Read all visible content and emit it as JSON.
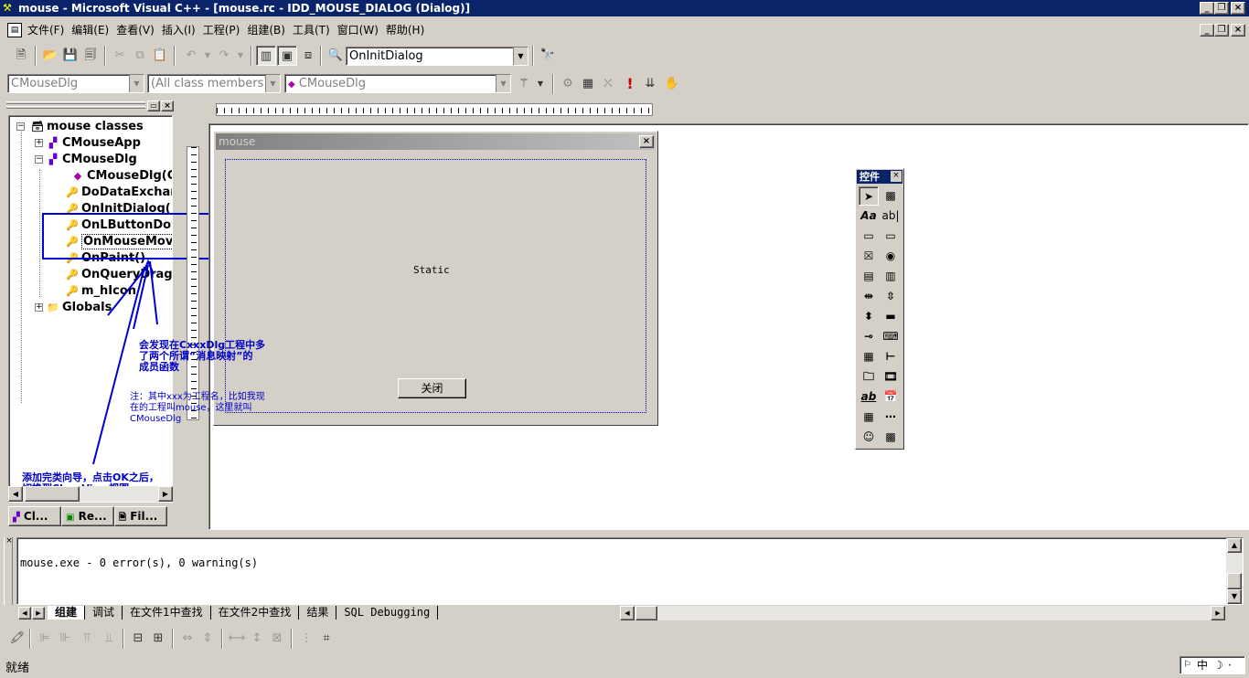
{
  "app": {
    "title": "mouse - Microsoft Visual C++ - [mouse.rc - IDD_MOUSE_DIALOG (Dialog)]",
    "title_buttons": [
      "_",
      "❐",
      "×"
    ],
    "inner_buttons": [
      "_",
      "❐",
      "×"
    ]
  },
  "menu": [
    "文件(F)",
    "编辑(E)",
    "查看(V)",
    "插入(I)",
    "工程(P)",
    "组建(B)",
    "工具(T)",
    "窗口(W)",
    "帮助(H)"
  ],
  "toolbar": {
    "find_combo_value": "OnInitDialog"
  },
  "wizardbar": {
    "class_combo": "CMouseDlg",
    "filter_combo": "(All class members)",
    "member_combo": "CMouseDlg"
  },
  "classview": {
    "root": "mouse classes",
    "items": [
      {
        "label": "CMouseApp"
      },
      {
        "label": "CMouseDlg"
      },
      {
        "label": "CMouseDlg(CWnd"
      },
      {
        "label": "DoDataExchange"
      },
      {
        "label": "OnInitDialog()"
      },
      {
        "label": "OnLButtonDown"
      },
      {
        "label": "OnMouseMove"
      },
      {
        "label": "OnPaint()"
      },
      {
        "label": "OnQueryDragIcon"
      },
      {
        "label": "m_hIcon"
      },
      {
        "label": "Globals"
      }
    ],
    "tabs": [
      "Cl...",
      "Re...",
      "Fil..."
    ]
  },
  "annotations": {
    "a1_line1": "会发现在CxxxDlg工程中多",
    "a1_line2": "了两个所谓“消息映射”的",
    "a1_line3": "成员函数",
    "a2_line1": "注：其中xxx为工程名，比如我现",
    "a2_line2": "在的工程叫mouse，这里就叫",
    "a2_line3": "CMouseDlg",
    "a3_line1": "添加完类向导，点击OK之后，",
    "a3_line2": "切换到ClassView视图"
  },
  "dialog": {
    "title": "mouse",
    "static_text": "Static",
    "close_button": "关闭"
  },
  "controls_palette": {
    "title": "控件"
  },
  "output": {
    "text": "mouse.exe - 0 error(s), 0 warning(s)",
    "tabs": [
      "组建",
      "调试",
      "在文件1中查找",
      "在文件2中查找",
      "结果",
      "SQL Debugging"
    ]
  },
  "status": {
    "text": "就绪",
    "ime": "中"
  }
}
